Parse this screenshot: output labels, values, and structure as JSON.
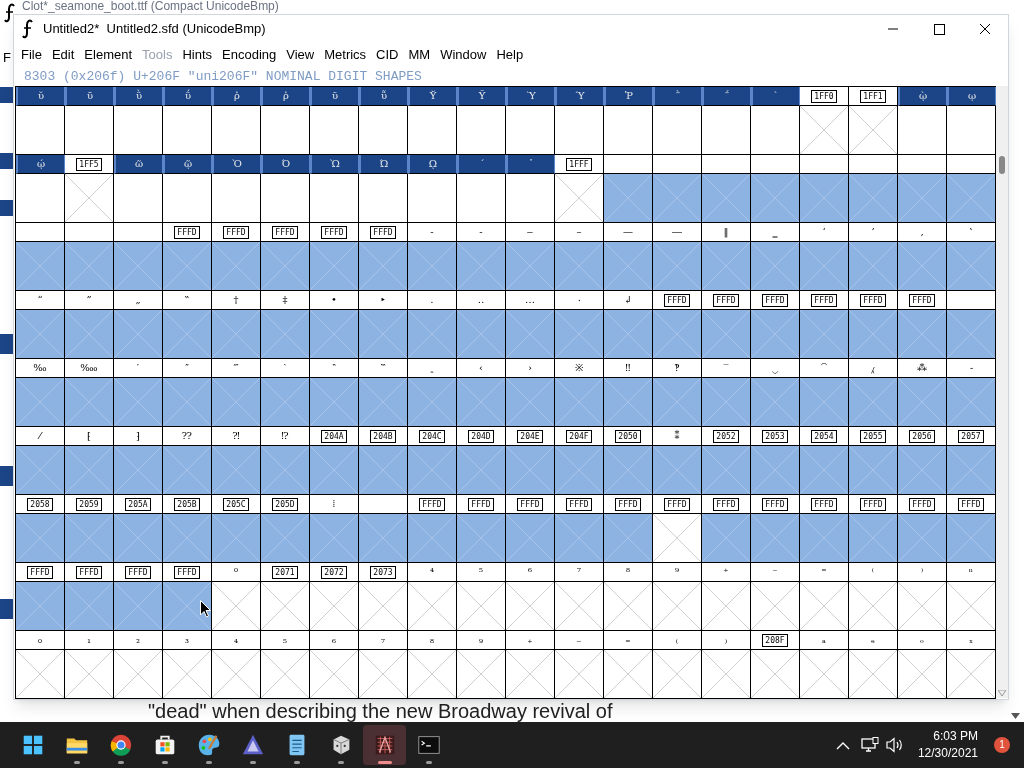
{
  "back_window": {
    "title": "Clot*_seamone_boot.ttf (Compact UnicodeBmp)",
    "menu_letter": "F",
    "text": "\"dead\" when describing the new Broadway revival of"
  },
  "window": {
    "title": "Untitled2*  Untitled2.sfd (UnicodeBmp)"
  },
  "menu": [
    {
      "label": "File",
      "disabled": false
    },
    {
      "label": "Edit",
      "disabled": false
    },
    {
      "label": "Element",
      "disabled": false
    },
    {
      "label": "Tools",
      "disabled": true
    },
    {
      "label": "Hints",
      "disabled": false
    },
    {
      "label": "Encoding",
      "disabled": false
    },
    {
      "label": "View",
      "disabled": false
    },
    {
      "label": "Metrics",
      "disabled": false
    },
    {
      "label": "CID",
      "disabled": false
    },
    {
      "label": "MM",
      "disabled": false
    },
    {
      "label": "Window",
      "disabled": false
    },
    {
      "label": "Help",
      "disabled": false
    }
  ],
  "status": "8303 (0x206f) U+206F \"uni206F\" NOMINAL DIGIT SHAPES",
  "rows": [
    {
      "cells": [
        {
          "kind": "char",
          "label": "ῠ",
          "selected": true,
          "highlighted": false,
          "missing": false
        },
        {
          "kind": "char",
          "label": "ῡ",
          "selected": true,
          "highlighted": false,
          "missing": false
        },
        {
          "kind": "char",
          "label": "ῢ",
          "selected": true,
          "highlighted": false,
          "missing": false
        },
        {
          "kind": "char",
          "label": "ΰ",
          "selected": true,
          "highlighted": false,
          "missing": false
        },
        {
          "kind": "char",
          "label": "ῤ",
          "selected": true,
          "highlighted": false,
          "missing": false
        },
        {
          "kind": "char",
          "label": "ῥ",
          "selected": true,
          "highlighted": false,
          "missing": false
        },
        {
          "kind": "char",
          "label": "ῦ",
          "selected": true,
          "highlighted": false,
          "missing": false
        },
        {
          "kind": "char",
          "label": "ῧ",
          "selected": true,
          "highlighted": false,
          "missing": false
        },
        {
          "kind": "char",
          "label": "Ῠ",
          "selected": true,
          "highlighted": false,
          "missing": false
        },
        {
          "kind": "char",
          "label": "Ῡ",
          "selected": true,
          "highlighted": false,
          "missing": false
        },
        {
          "kind": "char",
          "label": "Ὺ",
          "selected": true,
          "highlighted": false,
          "missing": false
        },
        {
          "kind": "char",
          "label": "Ύ",
          "selected": true,
          "highlighted": false,
          "missing": false
        },
        {
          "kind": "char",
          "label": "Ῥ",
          "selected": true,
          "highlighted": false,
          "missing": false
        },
        {
          "kind": "char",
          "label": "῭",
          "selected": true,
          "highlighted": false,
          "missing": false
        },
        {
          "kind": "char",
          "label": "΅",
          "selected": true,
          "highlighted": false,
          "missing": false
        },
        {
          "kind": "char",
          "label": "`",
          "selected": true,
          "highlighted": false,
          "missing": false
        },
        {
          "kind": "code",
          "label": "1FF0",
          "selected": false,
          "highlighted": false,
          "missing": true
        },
        {
          "kind": "code",
          "label": "1FF1",
          "selected": false,
          "highlighted": false,
          "missing": true
        },
        {
          "kind": "char",
          "label": "ῲ",
          "selected": true,
          "highlighted": false,
          "missing": false
        },
        {
          "kind": "char",
          "label": "ῳ",
          "selected": true,
          "highlighted": false,
          "missing": false
        }
      ]
    },
    {
      "cells": [
        {
          "kind": "char",
          "label": "ῴ",
          "selected": true,
          "highlighted": false,
          "missing": false
        },
        {
          "kind": "code",
          "label": "1FF5",
          "selected": false,
          "highlighted": false,
          "missing": true
        },
        {
          "kind": "char",
          "label": "ῶ",
          "selected": true,
          "highlighted": false,
          "missing": false
        },
        {
          "kind": "char",
          "label": "ῷ",
          "selected": true,
          "highlighted": false,
          "missing": false
        },
        {
          "kind": "char",
          "label": "Ὸ",
          "selected": true,
          "highlighted": false,
          "missing": false
        },
        {
          "kind": "char",
          "label": "Ό",
          "selected": true,
          "highlighted": false,
          "missing": false
        },
        {
          "kind": "char",
          "label": "Ὼ",
          "selected": true,
          "highlighted": false,
          "missing": false
        },
        {
          "kind": "char",
          "label": "Ώ",
          "selected": true,
          "highlighted": false,
          "missing": false
        },
        {
          "kind": "char",
          "label": "ῼ",
          "selected": true,
          "highlighted": false,
          "missing": false
        },
        {
          "kind": "char",
          "label": "´",
          "selected": true,
          "highlighted": false,
          "missing": false
        },
        {
          "kind": "char",
          "label": "῾",
          "selected": true,
          "highlighted": false,
          "missing": false
        },
        {
          "kind": "code",
          "label": "1FFF",
          "selected": false,
          "highlighted": false,
          "missing": true
        },
        {
          "kind": "blank",
          "selected": false,
          "highlighted": true,
          "missing": true
        },
        {
          "kind": "blank",
          "selected": false,
          "highlighted": true,
          "missing": true
        },
        {
          "kind": "blank",
          "selected": false,
          "highlighted": true,
          "missing": true
        },
        {
          "kind": "blank",
          "selected": false,
          "highlighted": true,
          "missing": true
        },
        {
          "kind": "blank",
          "selected": false,
          "highlighted": true,
          "missing": true
        },
        {
          "kind": "blank",
          "selected": false,
          "highlighted": true,
          "missing": true
        },
        {
          "kind": "blank",
          "selected": false,
          "highlighted": true,
          "missing": true
        },
        {
          "kind": "blank",
          "selected": false,
          "highlighted": true,
          "missing": true
        }
      ]
    },
    {
      "cells": [
        {
          "kind": "blank",
          "selected": false,
          "highlighted": true,
          "missing": true
        },
        {
          "kind": "blank",
          "selected": false,
          "highlighted": true,
          "missing": true
        },
        {
          "kind": "blank",
          "selected": false,
          "highlighted": true,
          "missing": true
        },
        {
          "kind": "code",
          "label": "FFFD",
          "selected": false,
          "highlighted": true,
          "missing": true
        },
        {
          "kind": "code",
          "label": "FFFD",
          "selected": false,
          "highlighted": true,
          "missing": true
        },
        {
          "kind": "code",
          "label": "FFFD",
          "selected": false,
          "highlighted": true,
          "missing": true
        },
        {
          "kind": "code",
          "label": "FFFD",
          "selected": false,
          "highlighted": true,
          "missing": true
        },
        {
          "kind": "code",
          "label": "FFFD",
          "selected": false,
          "highlighted": true,
          "missing": true
        },
        {
          "kind": "char",
          "label": "‐",
          "selected": false,
          "highlighted": true,
          "missing": true
        },
        {
          "kind": "char",
          "label": "‑",
          "selected": false,
          "highlighted": true,
          "missing": true
        },
        {
          "kind": "char",
          "label": "‒",
          "selected": false,
          "highlighted": true,
          "missing": true
        },
        {
          "kind": "char",
          "label": "–",
          "selected": false,
          "highlighted": true,
          "missing": true
        },
        {
          "kind": "char",
          "label": "—",
          "selected": false,
          "highlighted": true,
          "missing": true
        },
        {
          "kind": "char",
          "label": "―",
          "selected": false,
          "highlighted": true,
          "missing": true
        },
        {
          "kind": "char",
          "label": "‖",
          "selected": false,
          "highlighted": true,
          "missing": true
        },
        {
          "kind": "char",
          "label": "‗",
          "selected": false,
          "highlighted": true,
          "missing": true
        },
        {
          "kind": "char",
          "label": "‘",
          "selected": false,
          "highlighted": true,
          "missing": true
        },
        {
          "kind": "char",
          "label": "’",
          "selected": false,
          "highlighted": true,
          "missing": true
        },
        {
          "kind": "char",
          "label": "‚",
          "selected": false,
          "highlighted": true,
          "missing": true
        },
        {
          "kind": "char",
          "label": "‛",
          "selected": false,
          "highlighted": true,
          "missing": true
        }
      ]
    },
    {
      "cells": [
        {
          "kind": "char",
          "label": "“",
          "selected": false,
          "highlighted": true,
          "missing": true
        },
        {
          "kind": "char",
          "label": "”",
          "selected": false,
          "highlighted": true,
          "missing": true
        },
        {
          "kind": "char",
          "label": "„",
          "selected": false,
          "highlighted": true,
          "missing": true
        },
        {
          "kind": "char",
          "label": "‟",
          "selected": false,
          "highlighted": true,
          "missing": true
        },
        {
          "kind": "char",
          "label": "†",
          "selected": false,
          "highlighted": true,
          "missing": true
        },
        {
          "kind": "char",
          "label": "‡",
          "selected": false,
          "highlighted": true,
          "missing": true
        },
        {
          "kind": "char",
          "label": "•",
          "selected": false,
          "highlighted": true,
          "missing": true
        },
        {
          "kind": "char",
          "label": "‣",
          "selected": false,
          "highlighted": true,
          "missing": true
        },
        {
          "kind": "char",
          "label": "․",
          "selected": false,
          "highlighted": true,
          "missing": true
        },
        {
          "kind": "char",
          "label": "‥",
          "selected": false,
          "highlighted": true,
          "missing": true
        },
        {
          "kind": "char",
          "label": "…",
          "selected": false,
          "highlighted": true,
          "missing": true
        },
        {
          "kind": "char",
          "label": "‧",
          "selected": false,
          "highlighted": true,
          "missing": true
        },
        {
          "kind": "char",
          "label": "↲",
          "selected": false,
          "highlighted": true,
          "missing": true
        },
        {
          "kind": "code",
          "label": "FFFD",
          "selected": false,
          "highlighted": true,
          "missing": true
        },
        {
          "kind": "code",
          "label": "FFFD",
          "selected": false,
          "highlighted": true,
          "missing": true
        },
        {
          "kind": "code",
          "label": "FFFD",
          "selected": false,
          "highlighted": true,
          "missing": true
        },
        {
          "kind": "code",
          "label": "FFFD",
          "selected": false,
          "highlighted": true,
          "missing": true
        },
        {
          "kind": "code",
          "label": "FFFD",
          "selected": false,
          "highlighted": true,
          "missing": true
        },
        {
          "kind": "code",
          "label": "FFFD",
          "selected": false,
          "highlighted": true,
          "missing": true
        },
        {
          "kind": "blank",
          "selected": false,
          "highlighted": true,
          "missing": true
        }
      ]
    },
    {
      "cells": [
        {
          "kind": "char",
          "label": "‰",
          "selected": false,
          "highlighted": true,
          "missing": true
        },
        {
          "kind": "char",
          "label": "‱",
          "selected": false,
          "highlighted": true,
          "missing": true
        },
        {
          "kind": "char",
          "label": "′",
          "selected": false,
          "highlighted": true,
          "missing": true
        },
        {
          "kind": "char",
          "label": "″",
          "selected": false,
          "highlighted": true,
          "missing": true
        },
        {
          "kind": "char",
          "label": "‴",
          "selected": false,
          "highlighted": true,
          "missing": true
        },
        {
          "kind": "char",
          "label": "‵",
          "selected": false,
          "highlighted": true,
          "missing": true
        },
        {
          "kind": "char",
          "label": "‶",
          "selected": false,
          "highlighted": true,
          "missing": true
        },
        {
          "kind": "char",
          "label": "‷",
          "selected": false,
          "highlighted": true,
          "missing": true
        },
        {
          "kind": "char",
          "label": "‸",
          "selected": false,
          "highlighted": true,
          "missing": true
        },
        {
          "kind": "char",
          "label": "‹",
          "selected": false,
          "highlighted": true,
          "missing": true
        },
        {
          "kind": "char",
          "label": "›",
          "selected": false,
          "highlighted": true,
          "missing": true
        },
        {
          "kind": "char",
          "label": "※",
          "selected": false,
          "highlighted": true,
          "missing": true
        },
        {
          "kind": "char",
          "label": "‼",
          "selected": false,
          "highlighted": true,
          "missing": true
        },
        {
          "kind": "char",
          "label": "‽",
          "selected": false,
          "highlighted": true,
          "missing": true
        },
        {
          "kind": "char",
          "label": "‾",
          "selected": false,
          "highlighted": true,
          "missing": true
        },
        {
          "kind": "char",
          "label": "‿",
          "selected": false,
          "highlighted": true,
          "missing": true
        },
        {
          "kind": "char",
          "label": "⁀",
          "selected": false,
          "highlighted": true,
          "missing": true
        },
        {
          "kind": "char",
          "label": "⁁",
          "selected": false,
          "highlighted": true,
          "missing": true
        },
        {
          "kind": "char",
          "label": "⁂",
          "selected": false,
          "highlighted": true,
          "missing": true
        },
        {
          "kind": "char",
          "label": "⁃",
          "selected": false,
          "highlighted": true,
          "missing": true
        }
      ]
    },
    {
      "cells": [
        {
          "kind": "char",
          "label": "⁄",
          "selected": false,
          "highlighted": true,
          "missing": true
        },
        {
          "kind": "char",
          "label": "⁅",
          "selected": false,
          "highlighted": true,
          "missing": true
        },
        {
          "kind": "char",
          "label": "⁆",
          "selected": false,
          "highlighted": true,
          "missing": true
        },
        {
          "kind": "char",
          "label": "⁇",
          "selected": false,
          "highlighted": true,
          "missing": true
        },
        {
          "kind": "char",
          "label": "⁈",
          "selected": false,
          "highlighted": true,
          "missing": true
        },
        {
          "kind": "char",
          "label": "⁉",
          "selected": false,
          "highlighted": true,
          "missing": true
        },
        {
          "kind": "code",
          "label": "204A",
          "selected": false,
          "highlighted": true,
          "missing": true
        },
        {
          "kind": "code",
          "label": "204B",
          "selected": false,
          "highlighted": true,
          "missing": true
        },
        {
          "kind": "code",
          "label": "204C",
          "selected": false,
          "highlighted": true,
          "missing": true
        },
        {
          "kind": "code",
          "label": "204D",
          "selected": false,
          "highlighted": true,
          "missing": true
        },
        {
          "kind": "code",
          "label": "204E",
          "selected": false,
          "highlighted": true,
          "missing": true
        },
        {
          "kind": "code",
          "label": "204F",
          "selected": false,
          "highlighted": true,
          "missing": true
        },
        {
          "kind": "code",
          "label": "2050",
          "selected": false,
          "highlighted": true,
          "missing": true
        },
        {
          "kind": "char",
          "label": "⁑",
          "selected": false,
          "highlighted": true,
          "missing": true
        },
        {
          "kind": "code",
          "label": "2052",
          "selected": false,
          "highlighted": true,
          "missing": true
        },
        {
          "kind": "code",
          "label": "2053",
          "selected": false,
          "highlighted": true,
          "missing": true
        },
        {
          "kind": "code",
          "label": "2054",
          "selected": false,
          "highlighted": true,
          "missing": true
        },
        {
          "kind": "code",
          "label": "2055",
          "selected": false,
          "highlighted": true,
          "missing": true
        },
        {
          "kind": "code",
          "label": "2056",
          "selected": false,
          "highlighted": true,
          "missing": true
        },
        {
          "kind": "code",
          "label": "2057",
          "selected": false,
          "highlighted": true,
          "missing": true
        }
      ]
    },
    {
      "cells": [
        {
          "kind": "code",
          "label": "2058",
          "selected": false,
          "highlighted": true,
          "missing": true
        },
        {
          "kind": "code",
          "label": "2059",
          "selected": false,
          "highlighted": true,
          "missing": true
        },
        {
          "kind": "code",
          "label": "205A",
          "selected": false,
          "highlighted": true,
          "missing": true
        },
        {
          "kind": "code",
          "label": "205B",
          "selected": false,
          "highlighted": true,
          "missing": true
        },
        {
          "kind": "code",
          "label": "205C",
          "selected": false,
          "highlighted": true,
          "missing": true
        },
        {
          "kind": "code",
          "label": "205D",
          "selected": false,
          "highlighted": true,
          "missing": true
        },
        {
          "kind": "char",
          "label": "⁞",
          "selected": false,
          "highlighted": true,
          "missing": true
        },
        {
          "kind": "blank",
          "selected": false,
          "highlighted": true,
          "missing": true
        },
        {
          "kind": "code",
          "label": "FFFD",
          "selected": false,
          "highlighted": true,
          "missing": true
        },
        {
          "kind": "code",
          "label": "FFFD",
          "selected": false,
          "highlighted": true,
          "missing": true
        },
        {
          "kind": "code",
          "label": "FFFD",
          "selected": false,
          "highlighted": true,
          "missing": true
        },
        {
          "kind": "code",
          "label": "FFFD",
          "selected": false,
          "highlighted": true,
          "missing": true
        },
        {
          "kind": "code",
          "label": "FFFD",
          "selected": false,
          "highlighted": true,
          "missing": true
        },
        {
          "kind": "code",
          "label": "FFFD",
          "selected": false,
          "highlighted": false,
          "missing": true
        },
        {
          "kind": "code",
          "label": "FFFD",
          "selected": false,
          "highlighted": true,
          "missing": true
        },
        {
          "kind": "code",
          "label": "FFFD",
          "selected": false,
          "highlighted": true,
          "missing": true
        },
        {
          "kind": "code",
          "label": "FFFD",
          "selected": false,
          "highlighted": true,
          "missing": true
        },
        {
          "kind": "code",
          "label": "FFFD",
          "selected": false,
          "highlighted": true,
          "missing": true
        },
        {
          "kind": "code",
          "label": "FFFD",
          "selected": false,
          "highlighted": true,
          "missing": true
        },
        {
          "kind": "code",
          "label": "FFFD",
          "selected": false,
          "highlighted": true,
          "missing": true
        }
      ]
    },
    {
      "cells": [
        {
          "kind": "code",
          "label": "FFFD",
          "selected": false,
          "highlighted": true,
          "missing": true
        },
        {
          "kind": "code",
          "label": "FFFD",
          "selected": false,
          "highlighted": true,
          "missing": true
        },
        {
          "kind": "code",
          "label": "FFFD",
          "selected": false,
          "highlighted": true,
          "missing": true
        },
        {
          "kind": "code",
          "label": "FFFD",
          "selected": false,
          "highlighted": true,
          "missing": true
        },
        {
          "kind": "char",
          "label": "⁰",
          "selected": false,
          "highlighted": false,
          "missing": true
        },
        {
          "kind": "code",
          "label": "2071",
          "selected": false,
          "highlighted": false,
          "missing": true
        },
        {
          "kind": "code",
          "label": "2072",
          "selected": false,
          "highlighted": false,
          "missing": true
        },
        {
          "kind": "code",
          "label": "2073",
          "selected": false,
          "highlighted": false,
          "missing": true
        },
        {
          "kind": "char",
          "label": "⁴",
          "selected": false,
          "highlighted": false,
          "missing": true
        },
        {
          "kind": "char",
          "label": "⁵",
          "selected": false,
          "highlighted": false,
          "missing": true
        },
        {
          "kind": "char",
          "label": "⁶",
          "selected": false,
          "highlighted": false,
          "missing": true
        },
        {
          "kind": "char",
          "label": "⁷",
          "selected": false,
          "highlighted": false,
          "missing": true
        },
        {
          "kind": "char",
          "label": "⁸",
          "selected": false,
          "highlighted": false,
          "missing": true
        },
        {
          "kind": "char",
          "label": "⁹",
          "selected": false,
          "highlighted": false,
          "missing": true
        },
        {
          "kind": "char",
          "label": "⁺",
          "selected": false,
          "highlighted": false,
          "missing": true
        },
        {
          "kind": "char",
          "label": "⁻",
          "selected": false,
          "highlighted": false,
          "missing": true
        },
        {
          "kind": "char",
          "label": "⁼",
          "selected": false,
          "highlighted": false,
          "missing": true
        },
        {
          "kind": "char",
          "label": "⁽",
          "selected": false,
          "highlighted": false,
          "missing": true
        },
        {
          "kind": "char",
          "label": "⁾",
          "selected": false,
          "highlighted": false,
          "missing": true
        },
        {
          "kind": "char",
          "label": "ⁿ",
          "selected": false,
          "highlighted": false,
          "missing": true
        }
      ]
    },
    {
      "cells": [
        {
          "kind": "char",
          "label": "₀",
          "selected": false,
          "highlighted": false,
          "missing": true
        },
        {
          "kind": "char",
          "label": "₁",
          "selected": false,
          "highlighted": false,
          "missing": true
        },
        {
          "kind": "char",
          "label": "₂",
          "selected": false,
          "highlighted": false,
          "missing": true
        },
        {
          "kind": "char",
          "label": "₃",
          "selected": false,
          "highlighted": false,
          "missing": true
        },
        {
          "kind": "char",
          "label": "₄",
          "selected": false,
          "highlighted": false,
          "missing": true
        },
        {
          "kind": "char",
          "label": "₅",
          "selected": false,
          "highlighted": false,
          "missing": true
        },
        {
          "kind": "char",
          "label": "₆",
          "selected": false,
          "highlighted": false,
          "missing": true
        },
        {
          "kind": "char",
          "label": "₇",
          "selected": false,
          "highlighted": false,
          "missing": true
        },
        {
          "kind": "char",
          "label": "₈",
          "selected": false,
          "highlighted": false,
          "missing": true
        },
        {
          "kind": "char",
          "label": "₉",
          "selected": false,
          "highlighted": false,
          "missing": true
        },
        {
          "kind": "char",
          "label": "₊",
          "selected": false,
          "highlighted": false,
          "missing": true
        },
        {
          "kind": "char",
          "label": "₋",
          "selected": false,
          "highlighted": false,
          "missing": true
        },
        {
          "kind": "char",
          "label": "₌",
          "selected": false,
          "highlighted": false,
          "missing": true
        },
        {
          "kind": "char",
          "label": "₍",
          "selected": false,
          "highlighted": false,
          "missing": true
        },
        {
          "kind": "char",
          "label": "₎",
          "selected": false,
          "highlighted": false,
          "missing": true
        },
        {
          "kind": "code",
          "label": "208F",
          "selected": false,
          "highlighted": false,
          "missing": true
        },
        {
          "kind": "char",
          "label": "ₐ",
          "selected": false,
          "highlighted": false,
          "missing": true
        },
        {
          "kind": "char",
          "label": "ₑ",
          "selected": false,
          "highlighted": false,
          "missing": true
        },
        {
          "kind": "char",
          "label": "ₒ",
          "selected": false,
          "highlighted": false,
          "missing": true
        },
        {
          "kind": "char",
          "label": "ₓ",
          "selected": false,
          "highlighted": false,
          "missing": true
        }
      ]
    }
  ],
  "taskbar": {
    "apps": [
      {
        "kind": "start",
        "running": false,
        "selected": false
      },
      {
        "kind": "folder",
        "running": true,
        "selected": false
      },
      {
        "kind": "browser",
        "running": true,
        "selected": false
      },
      {
        "kind": "store",
        "running": true,
        "selected": false
      },
      {
        "kind": "paint",
        "running": true,
        "selected": false
      },
      {
        "kind": "triangle",
        "running": true,
        "selected": false
      },
      {
        "kind": "notepad",
        "running": true,
        "selected": false
      },
      {
        "kind": "dice",
        "running": true,
        "selected": false
      },
      {
        "kind": "fontforge",
        "running": true,
        "selected": true
      },
      {
        "kind": "terminal",
        "running": true,
        "selected": false
      }
    ],
    "time": "6:03 PM",
    "date": "12/30/2021",
    "notifications": "1"
  }
}
